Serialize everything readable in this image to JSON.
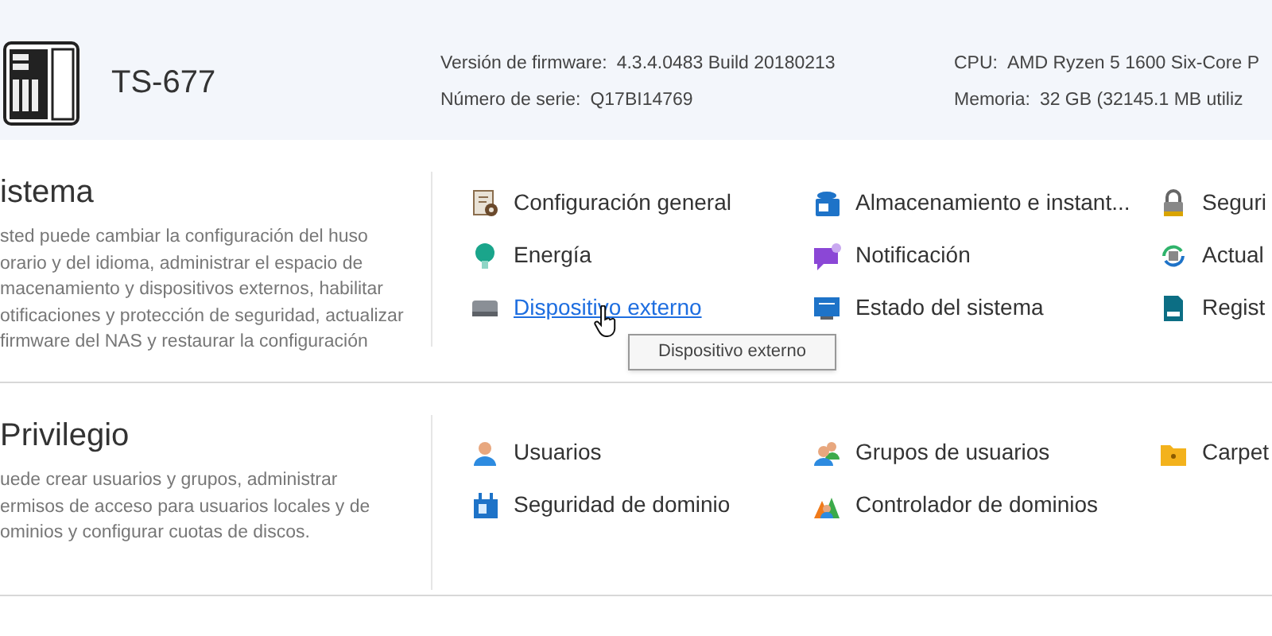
{
  "device": {
    "model": "TS-677",
    "info": [
      {
        "label": "Versión de firmware:",
        "value": "4.3.4.0483 Build 20180213"
      },
      {
        "label": "CPU:",
        "value": "AMD Ryzen 5 1600 Six-Core P"
      },
      {
        "label": "Número de serie:",
        "value": "Q17BI14769"
      },
      {
        "label": "Memoria:",
        "value": "32 GB (32145.1 MB utiliz"
      }
    ]
  },
  "sections": [
    {
      "title": "istema",
      "description_lines": [
        "sted puede cambiar la configuración del huso",
        "orario y del idioma, administrar el espacio de",
        "macenamiento y dispositivos externos, habilitar",
        "otificaciones y protección de seguridad, actualizar",
        "firmware del NAS y restaurar la configuración"
      ],
      "items": [
        {
          "label": "Configuración general",
          "hovered": false
        },
        {
          "label": "Almacenamiento e instant...",
          "hovered": false
        },
        {
          "label": "Seguri",
          "hovered": false
        },
        {
          "label": "Energía",
          "hovered": false
        },
        {
          "label": "Notificación",
          "hovered": false
        },
        {
          "label": "Actual",
          "hovered": false
        },
        {
          "label": "Dispositivo externo",
          "hovered": true,
          "tooltip": "Dispositivo externo"
        },
        {
          "label": "Estado del sistema",
          "hovered": false
        },
        {
          "label": "Regist",
          "hovered": false
        }
      ]
    },
    {
      "title": "Privilegio",
      "description_lines": [
        "uede crear usuarios y grupos, administrar",
        "ermisos de acceso para usuarios locales y de",
        "ominios y configurar cuotas de discos."
      ],
      "items": [
        {
          "label": "Usuarios",
          "hovered": false
        },
        {
          "label": "Grupos de usuarios",
          "hovered": false
        },
        {
          "label": "Carpet",
          "hovered": false
        },
        {
          "label": "Seguridad de dominio",
          "hovered": false
        },
        {
          "label": "Controlador de dominios",
          "hovered": false
        }
      ]
    }
  ]
}
